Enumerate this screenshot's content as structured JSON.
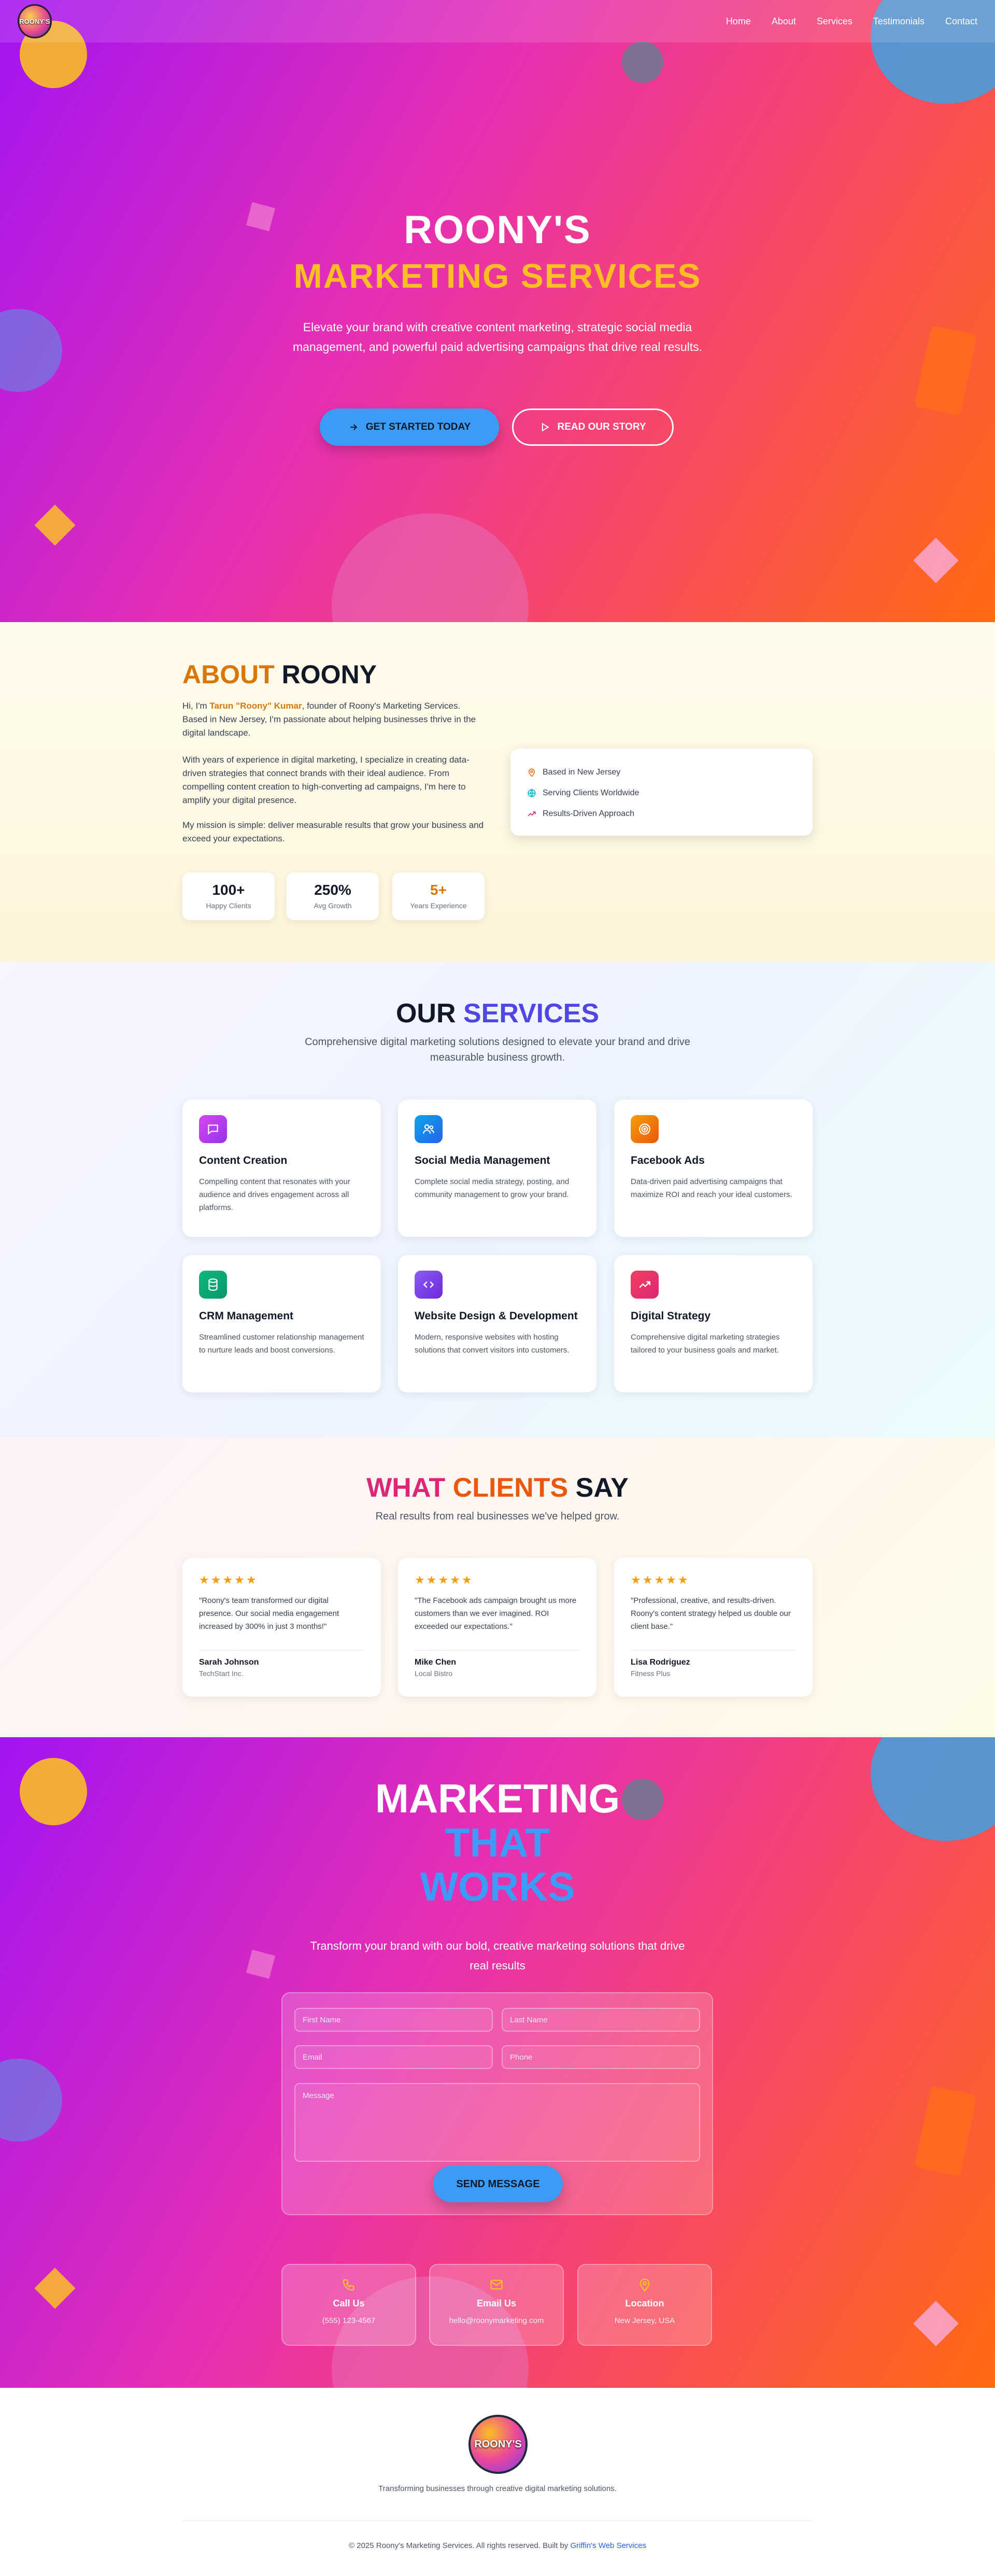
{
  "colors": {
    "accent_blue": "#3b9bf5",
    "gold": "#fbbf24",
    "orange": "#d97706",
    "indigo": "#4f46e5",
    "pink": "#db2777"
  },
  "nav": {
    "logo_text": "ROONY'S",
    "links": [
      "Home",
      "About",
      "Services",
      "Testimonials",
      "Contact"
    ]
  },
  "hero": {
    "title": "ROONY'S",
    "subtitle": "MARKETING SERVICES",
    "description": "Elevate your brand with creative content marketing, strategic social media management, and powerful paid advertising campaigns that drive real results.",
    "cta_primary": "GET STARTED TODAY",
    "cta_secondary": "READ OUR STORY"
  },
  "about": {
    "title_accent": "ABOUT",
    "title_main": "ROONY",
    "intro_pre": "Hi, I'm ",
    "intro_name": "Tarun \"Roony\" Kumar",
    "intro_post": ", founder of Roony's Marketing Services. Based in New Jersey, I'm passionate about helping businesses thrive in the digital landscape.",
    "para2": "With years of experience in digital marketing, I specialize in creating data-driven strategies that connect brands with their ideal audience. From compelling content creation to high-converting ad campaigns, I'm here to amplify your digital presence.",
    "para3": "My mission is simple: deliver measurable results that grow your business and exceed your expectations.",
    "stats": [
      {
        "value": "100+",
        "label": "Happy Clients"
      },
      {
        "value": "250%",
        "label": "Avg Growth"
      },
      {
        "value": "5+",
        "label": "Years Experience"
      }
    ],
    "info": [
      {
        "icon": "map-pin-icon",
        "text": "Based in New Jersey"
      },
      {
        "icon": "globe-icon",
        "text": "Serving Clients Worldwide"
      },
      {
        "icon": "trending-up-icon",
        "text": "Results-Driven Approach"
      }
    ]
  },
  "services": {
    "title_main": "OUR",
    "title_accent": "SERVICES",
    "description": "Comprehensive digital marketing solutions designed to elevate your brand and drive measurable business growth.",
    "items": [
      {
        "title": "Content Creation",
        "text": "Compelling content that resonates with your audience and drives engagement across all platforms.",
        "icon": "message-square-icon",
        "color": "#c026d3"
      },
      {
        "title": "Social Media Management",
        "text": "Complete social media strategy, posting, and community management to grow your brand.",
        "icon": "users-icon",
        "color": "#0ea5e9"
      },
      {
        "title": "Facebook Ads",
        "text": "Data-driven paid advertising campaigns that maximize ROI and reach your ideal customers.",
        "icon": "target-icon",
        "color": "#f59e0b"
      },
      {
        "title": "CRM Management",
        "text": "Streamlined customer relationship management to nurture leads and boost conversions.",
        "icon": "database-icon",
        "color": "#10b981"
      },
      {
        "title": "Website Design & Development",
        "text": "Modern, responsive websites with hosting solutions that convert visitors into customers.",
        "icon": "code-icon",
        "color": "#7c3aed"
      },
      {
        "title": "Digital Strategy",
        "text": "Comprehensive digital marketing strategies tailored to your business goals and market.",
        "icon": "trending-up-icon",
        "color": "#e11d48"
      }
    ]
  },
  "testimonials": {
    "title_a": "WHAT",
    "title_b": "CLIENTS",
    "title_c": "SAY",
    "description": "Real results from real businesses we've helped grow.",
    "stars": "★★★★★",
    "items": [
      {
        "quote": "\"Roony's team transformed our digital presence. Our social media engagement increased by 300% in just 3 months!\"",
        "name": "Sarah Johnson",
        "company": "TechStart Inc."
      },
      {
        "quote": "\"The Facebook ads campaign brought us more customers than we ever imagined. ROI exceeded our expectations.\"",
        "name": "Mike Chen",
        "company": "Local Bistro"
      },
      {
        "quote": "\"Professional, creative, and results-driven. Roony's content strategy helped us double our client base.\"",
        "name": "Lisa Rodriguez",
        "company": "Fitness Plus"
      }
    ]
  },
  "cta": {
    "line1": "MARKETING",
    "line2": "THAT",
    "line3": "WORKS",
    "description": "Transform your brand with our bold, creative marketing solutions that drive real results",
    "form": {
      "first_name": "First Name",
      "last_name": "Last Name",
      "email": "Email",
      "phone": "Phone",
      "message": "Message",
      "submit": "SEND MESSAGE"
    },
    "contacts": [
      {
        "icon": "phone-icon",
        "title": "Call Us",
        "value": "(555) 123-4567"
      },
      {
        "icon": "mail-icon",
        "title": "Email Us",
        "value": "hello@roonymarketing.com"
      },
      {
        "icon": "map-pin-icon",
        "title": "Location",
        "value": "New Jersey, USA"
      }
    ]
  },
  "footer": {
    "logo_text": "ROONY'S",
    "tagline": "Transforming businesses through creative digital marketing solutions.",
    "copyright": "© 2025 Roony's Marketing Services. All rights reserved. Built by ",
    "builder_link": "Griffin's Web Services"
  }
}
